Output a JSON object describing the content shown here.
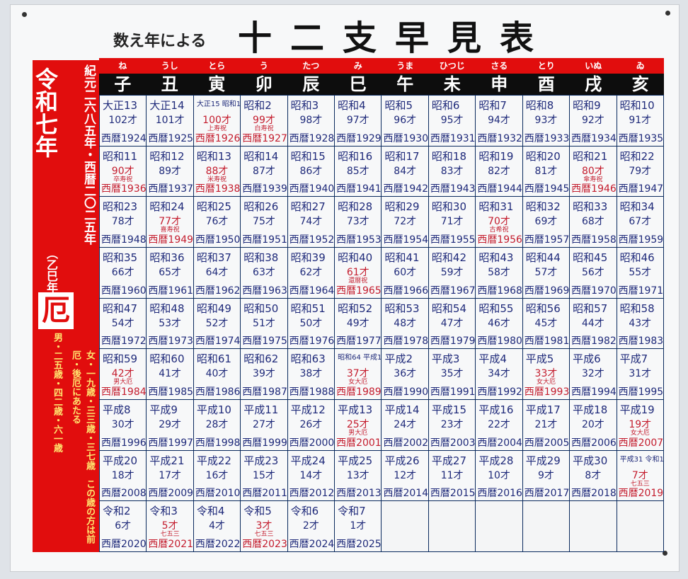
{
  "subtitle": "数え年による",
  "title": "十二支早見表",
  "left_panel": {
    "reiwa": "令和七年",
    "eto": "（乙巳年）",
    "kigen": "紀元二六八五年・西暦二〇二五年",
    "yaku": "厄",
    "men": "男・二五歳・四二歳・六一歳",
    "women": "女・一九歳・三三歳・三七歳　この歳の方は前厄・後厄にあたる"
  },
  "readings": [
    "ね",
    "うし",
    "とら",
    "う",
    "たつ",
    "み",
    "うま",
    "ひつじ",
    "さる",
    "とり",
    "いぬ",
    "ゐ"
  ],
  "zodiac": [
    "子",
    "丑",
    "寅",
    "卯",
    "辰",
    "巳",
    "午",
    "未",
    "申",
    "酉",
    "戌",
    "亥"
  ],
  "rows": [
    [
      {
        "era": "大正13",
        "age": "102才",
        "year": "西暦1924"
      },
      {
        "era": "大正14",
        "age": "101才",
        "year": "西暦1925"
      },
      {
        "era": "大正15 昭和1",
        "age": "100才",
        "note": "上寿祝",
        "year": "西暦1926",
        "special": true
      },
      {
        "era": "昭和2",
        "age": "99才",
        "note": "白寿祝",
        "year": "西暦1927",
        "special": true
      },
      {
        "era": "昭和3",
        "age": "98才",
        "year": "西暦1928"
      },
      {
        "era": "昭和4",
        "age": "97才",
        "year": "西暦1929"
      },
      {
        "era": "昭和5",
        "age": "96才",
        "year": "西暦1930"
      },
      {
        "era": "昭和6",
        "age": "95才",
        "year": "西暦1931"
      },
      {
        "era": "昭和7",
        "age": "94才",
        "year": "西暦1932"
      },
      {
        "era": "昭和8",
        "age": "93才",
        "year": "西暦1933"
      },
      {
        "era": "昭和9",
        "age": "92才",
        "year": "西暦1934"
      },
      {
        "era": "昭和10",
        "age": "91才",
        "year": "西暦1935"
      }
    ],
    [
      {
        "era": "昭和11",
        "age": "90才",
        "note": "卒寿祝",
        "year": "西暦1936",
        "special": true
      },
      {
        "era": "昭和12",
        "age": "89才",
        "year": "西暦1937"
      },
      {
        "era": "昭和13",
        "age": "88才",
        "note": "米寿祝",
        "year": "西暦1938",
        "special": true
      },
      {
        "era": "昭和14",
        "age": "87才",
        "year": "西暦1939"
      },
      {
        "era": "昭和15",
        "age": "86才",
        "year": "西暦1940"
      },
      {
        "era": "昭和16",
        "age": "85才",
        "year": "西暦1941"
      },
      {
        "era": "昭和17",
        "age": "84才",
        "year": "西暦1942"
      },
      {
        "era": "昭和18",
        "age": "83才",
        "year": "西暦1943"
      },
      {
        "era": "昭和19",
        "age": "82才",
        "year": "西暦1944"
      },
      {
        "era": "昭和20",
        "age": "81才",
        "year": "西暦1945"
      },
      {
        "era": "昭和21",
        "age": "80才",
        "note": "傘寿祝",
        "year": "西暦1946",
        "special": true
      },
      {
        "era": "昭和22",
        "age": "79才",
        "year": "西暦1947"
      }
    ],
    [
      {
        "era": "昭和23",
        "age": "78才",
        "year": "西暦1948"
      },
      {
        "era": "昭和24",
        "age": "77才",
        "note": "喜寿祝",
        "year": "西暦1949",
        "special": true
      },
      {
        "era": "昭和25",
        "age": "76才",
        "year": "西暦1950"
      },
      {
        "era": "昭和26",
        "age": "75才",
        "year": "西暦1951"
      },
      {
        "era": "昭和27",
        "age": "74才",
        "year": "西暦1952"
      },
      {
        "era": "昭和28",
        "age": "73才",
        "year": "西暦1953"
      },
      {
        "era": "昭和29",
        "age": "72才",
        "year": "西暦1954"
      },
      {
        "era": "昭和30",
        "age": "71才",
        "year": "西暦1955"
      },
      {
        "era": "昭和31",
        "age": "70才",
        "note": "古希祝",
        "year": "西暦1956",
        "special": true
      },
      {
        "era": "昭和32",
        "age": "69才",
        "year": "西暦1957"
      },
      {
        "era": "昭和33",
        "age": "68才",
        "year": "西暦1958"
      },
      {
        "era": "昭和34",
        "age": "67才",
        "year": "西暦1959"
      }
    ],
    [
      {
        "era": "昭和35",
        "age": "66才",
        "year": "西暦1960"
      },
      {
        "era": "昭和36",
        "age": "65才",
        "year": "西暦1961"
      },
      {
        "era": "昭和37",
        "age": "64才",
        "year": "西暦1962"
      },
      {
        "era": "昭和38",
        "age": "63才",
        "year": "西暦1963"
      },
      {
        "era": "昭和39",
        "age": "62才",
        "year": "西暦1964"
      },
      {
        "era": "昭和40",
        "age": "61才",
        "note": "還暦祝",
        "year": "西暦1965",
        "special": true
      },
      {
        "era": "昭和41",
        "age": "60才",
        "year": "西暦1966"
      },
      {
        "era": "昭和42",
        "age": "59才",
        "year": "西暦1967"
      },
      {
        "era": "昭和43",
        "age": "58才",
        "year": "西暦1968"
      },
      {
        "era": "昭和44",
        "age": "57才",
        "year": "西暦1969"
      },
      {
        "era": "昭和45",
        "age": "56才",
        "year": "西暦1970"
      },
      {
        "era": "昭和46",
        "age": "55才",
        "year": "西暦1971"
      }
    ],
    [
      {
        "era": "昭和47",
        "age": "54才",
        "year": "西暦1972"
      },
      {
        "era": "昭和48",
        "age": "53才",
        "year": "西暦1973"
      },
      {
        "era": "昭和49",
        "age": "52才",
        "year": "西暦1974"
      },
      {
        "era": "昭和50",
        "age": "51才",
        "year": "西暦1975"
      },
      {
        "era": "昭和51",
        "age": "50才",
        "year": "西暦1976"
      },
      {
        "era": "昭和52",
        "age": "49才",
        "year": "西暦1977"
      },
      {
        "era": "昭和53",
        "age": "48才",
        "year": "西暦1978"
      },
      {
        "era": "昭和54",
        "age": "47才",
        "year": "西暦1979"
      },
      {
        "era": "昭和55",
        "age": "46才",
        "year": "西暦1980"
      },
      {
        "era": "昭和56",
        "age": "45才",
        "year": "西暦1981"
      },
      {
        "era": "昭和57",
        "age": "44才",
        "year": "西暦1982"
      },
      {
        "era": "昭和58",
        "age": "43才",
        "year": "西暦1983"
      }
    ],
    [
      {
        "era": "昭和59",
        "age": "42才",
        "note": "男大厄",
        "year": "西暦1984",
        "special": true
      },
      {
        "era": "昭和60",
        "age": "41才",
        "year": "西暦1985"
      },
      {
        "era": "昭和61",
        "age": "40才",
        "year": "西暦1986"
      },
      {
        "era": "昭和62",
        "age": "39才",
        "year": "西暦1987"
      },
      {
        "era": "昭和63",
        "age": "38才",
        "year": "西暦1988"
      },
      {
        "era": "昭和64 平成1",
        "age": "37才",
        "note": "女大厄",
        "year": "西暦1989",
        "special": true
      },
      {
        "era": "平成2",
        "age": "36才",
        "year": "西暦1990"
      },
      {
        "era": "平成3",
        "age": "35才",
        "year": "西暦1991"
      },
      {
        "era": "平成4",
        "age": "34才",
        "year": "西暦1992"
      },
      {
        "era": "平成5",
        "age": "33才",
        "note": "女大厄",
        "year": "西暦1993",
        "special": true
      },
      {
        "era": "平成6",
        "age": "32才",
        "year": "西暦1994"
      },
      {
        "era": "平成7",
        "age": "31才",
        "year": "西暦1995"
      }
    ],
    [
      {
        "era": "平成8",
        "age": "30才",
        "year": "西暦1996"
      },
      {
        "era": "平成9",
        "age": "29才",
        "year": "西暦1997"
      },
      {
        "era": "平成10",
        "age": "28才",
        "year": "西暦1998"
      },
      {
        "era": "平成11",
        "age": "27才",
        "year": "西暦1999"
      },
      {
        "era": "平成12",
        "age": "26才",
        "year": "西暦2000"
      },
      {
        "era": "平成13",
        "age": "25才",
        "note": "男大厄",
        "year": "西暦2001",
        "special": true
      },
      {
        "era": "平成14",
        "age": "24才",
        "year": "西暦2002"
      },
      {
        "era": "平成15",
        "age": "23才",
        "year": "西暦2003"
      },
      {
        "era": "平成16",
        "age": "22才",
        "year": "西暦2004"
      },
      {
        "era": "平成17",
        "age": "21才",
        "year": "西暦2005"
      },
      {
        "era": "平成18",
        "age": "20才",
        "year": "西暦2006"
      },
      {
        "era": "平成19",
        "age": "19才",
        "note": "女大厄",
        "year": "西暦2007",
        "special": true
      }
    ],
    [
      {
        "era": "平成20",
        "age": "18才",
        "year": "西暦2008"
      },
      {
        "era": "平成21",
        "age": "17才",
        "year": "西暦2009"
      },
      {
        "era": "平成22",
        "age": "16才",
        "year": "西暦2010"
      },
      {
        "era": "平成23",
        "age": "15才",
        "year": "西暦2011"
      },
      {
        "era": "平成24",
        "age": "14才",
        "year": "西暦2012"
      },
      {
        "era": "平成25",
        "age": "13才",
        "year": "西暦2013"
      },
      {
        "era": "平成26",
        "age": "12才",
        "year": "西暦2014"
      },
      {
        "era": "平成27",
        "age": "11才",
        "year": "西暦2015"
      },
      {
        "era": "平成28",
        "age": "10才",
        "year": "西暦2016"
      },
      {
        "era": "平成29",
        "age": "9才",
        "year": "西暦2017"
      },
      {
        "era": "平成30",
        "age": "8才",
        "year": "西暦2018"
      },
      {
        "era": "平成31 令和1",
        "age": "7才",
        "note": "七五三",
        "year": "西暦2019",
        "special": true
      }
    ],
    [
      {
        "era": "令和2",
        "age": "6才",
        "year": "西暦2020"
      },
      {
        "era": "令和3",
        "age": "5才",
        "note": "七五三",
        "year": "西暦2021",
        "special": true
      },
      {
        "era": "令和4",
        "age": "4才",
        "year": "西暦2022"
      },
      {
        "era": "令和5",
        "age": "3才",
        "note": "七五三",
        "year": "西暦2023",
        "special": true
      },
      {
        "era": "令和6",
        "age": "2才",
        "year": "西暦2024"
      },
      {
        "era": "令和7",
        "age": "1才",
        "year": "西暦2025"
      },
      null,
      null,
      null,
      null,
      null,
      null
    ]
  ]
}
